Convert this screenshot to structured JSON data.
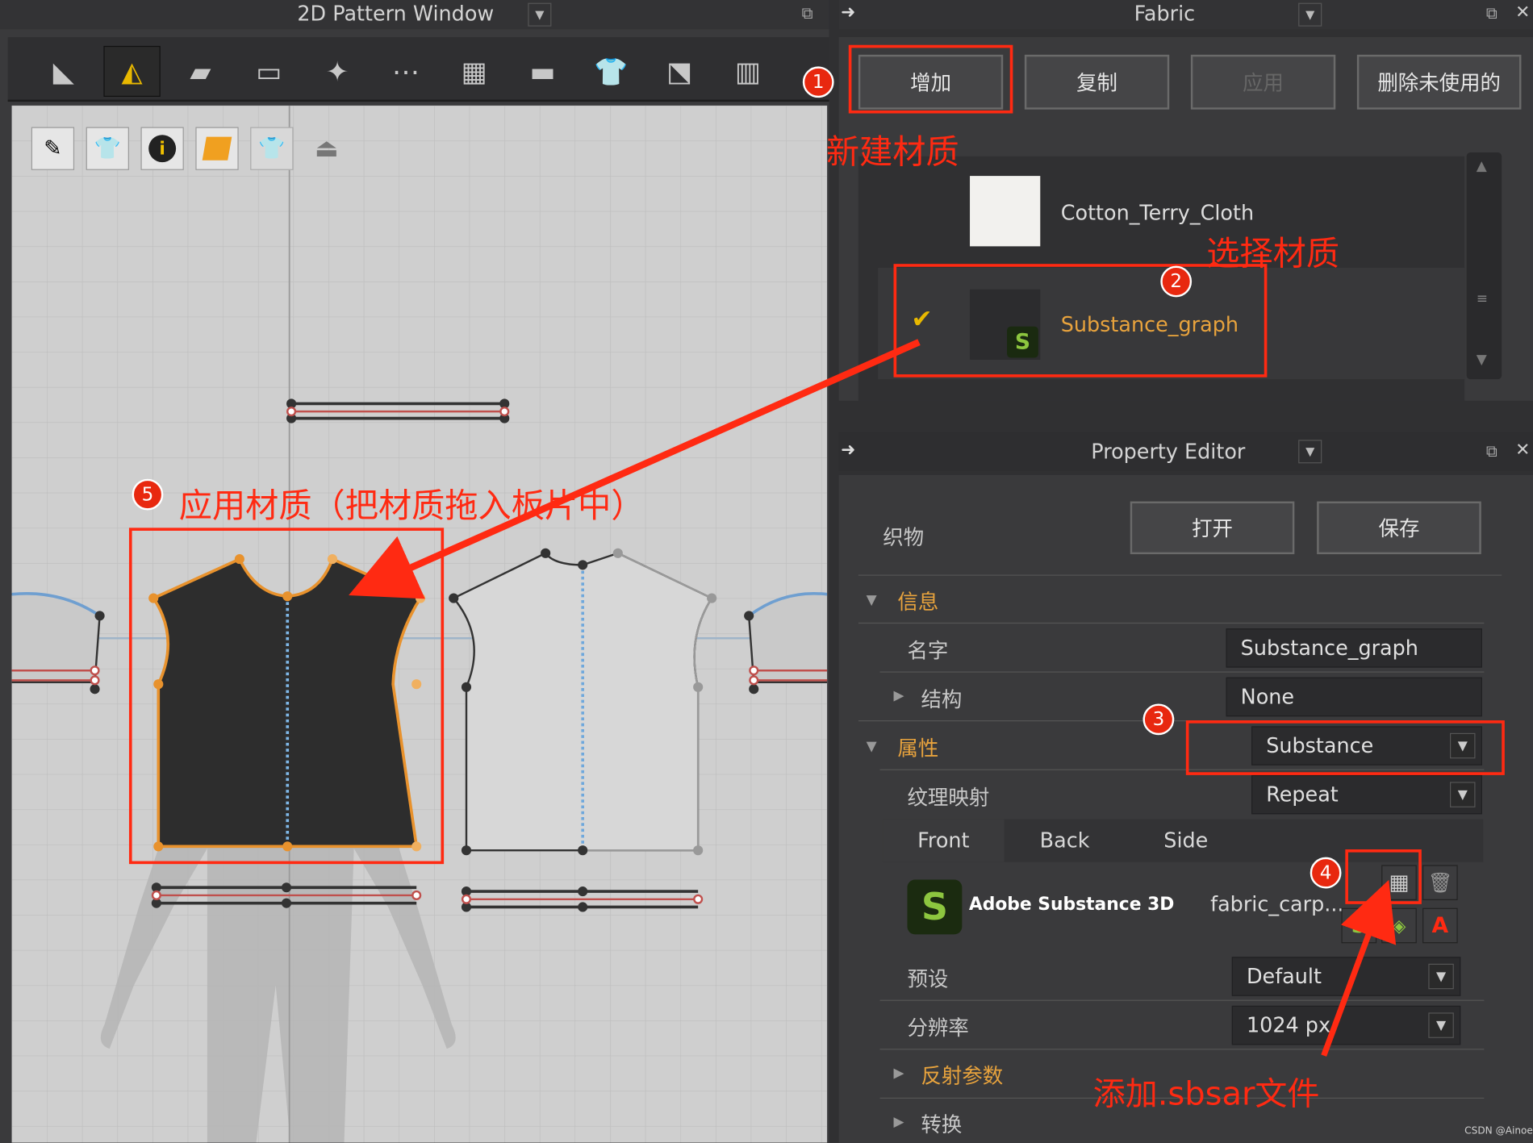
{
  "pattern_window": {
    "title": "2D Pattern Window",
    "dropdown_icon": "chevron-down-icon",
    "toolbar_icons": [
      "edit-pattern-icon",
      "edit-point-line-icon",
      "polygon-icon",
      "rectangle-icon",
      "transform-avatar-icon",
      "segment-icon",
      "grid-icon",
      "iron-icon",
      "shirt-icon",
      "brush-icon",
      "bars-icon"
    ]
  },
  "fabric_panel": {
    "title": "Fabric",
    "buttons": {
      "add": "增加",
      "copy": "复制",
      "apply": "应用",
      "delete_unused": "删除未使用的"
    },
    "items": [
      {
        "name": "Cotton_Terry_Cloth",
        "selected": false
      },
      {
        "name": "Substance_graph",
        "selected": true
      }
    ]
  },
  "property_editor": {
    "title": "Property Editor",
    "fabric_label": "织物",
    "open": "打开",
    "save": "保存",
    "info_section": "信息",
    "name_label": "名字",
    "name_value": "Substance_graph",
    "structure_label": "结构",
    "structure_value": "None",
    "attr_section": "属性",
    "attr_value": "Substance",
    "texmap_label": "纹理映射",
    "texmap_value": "Repeat",
    "tabs": [
      "Front",
      "Back",
      "Side"
    ],
    "substance_brand": "Adobe Substance 3D",
    "substance_file": "fabric_carp...",
    "preset_label": "预设",
    "preset_value": "Default",
    "res_label": "分辨率",
    "res_value": "1024 px",
    "reflect_section": "反射参数",
    "transform_section": "转换"
  },
  "annotations": {
    "a1": "新建材质",
    "a2": "选择材质",
    "a4": "添加.sbsar文件",
    "a5": "应用材质（把材质拖入板片中）",
    "badges": [
      "1",
      "2",
      "3",
      "4",
      "5"
    ]
  },
  "watermark": "CSDN @Ainoe",
  "colors": {
    "accent": "#e8a33d",
    "annotation": "#ff2a12",
    "substance_green": "#8dc63f"
  }
}
